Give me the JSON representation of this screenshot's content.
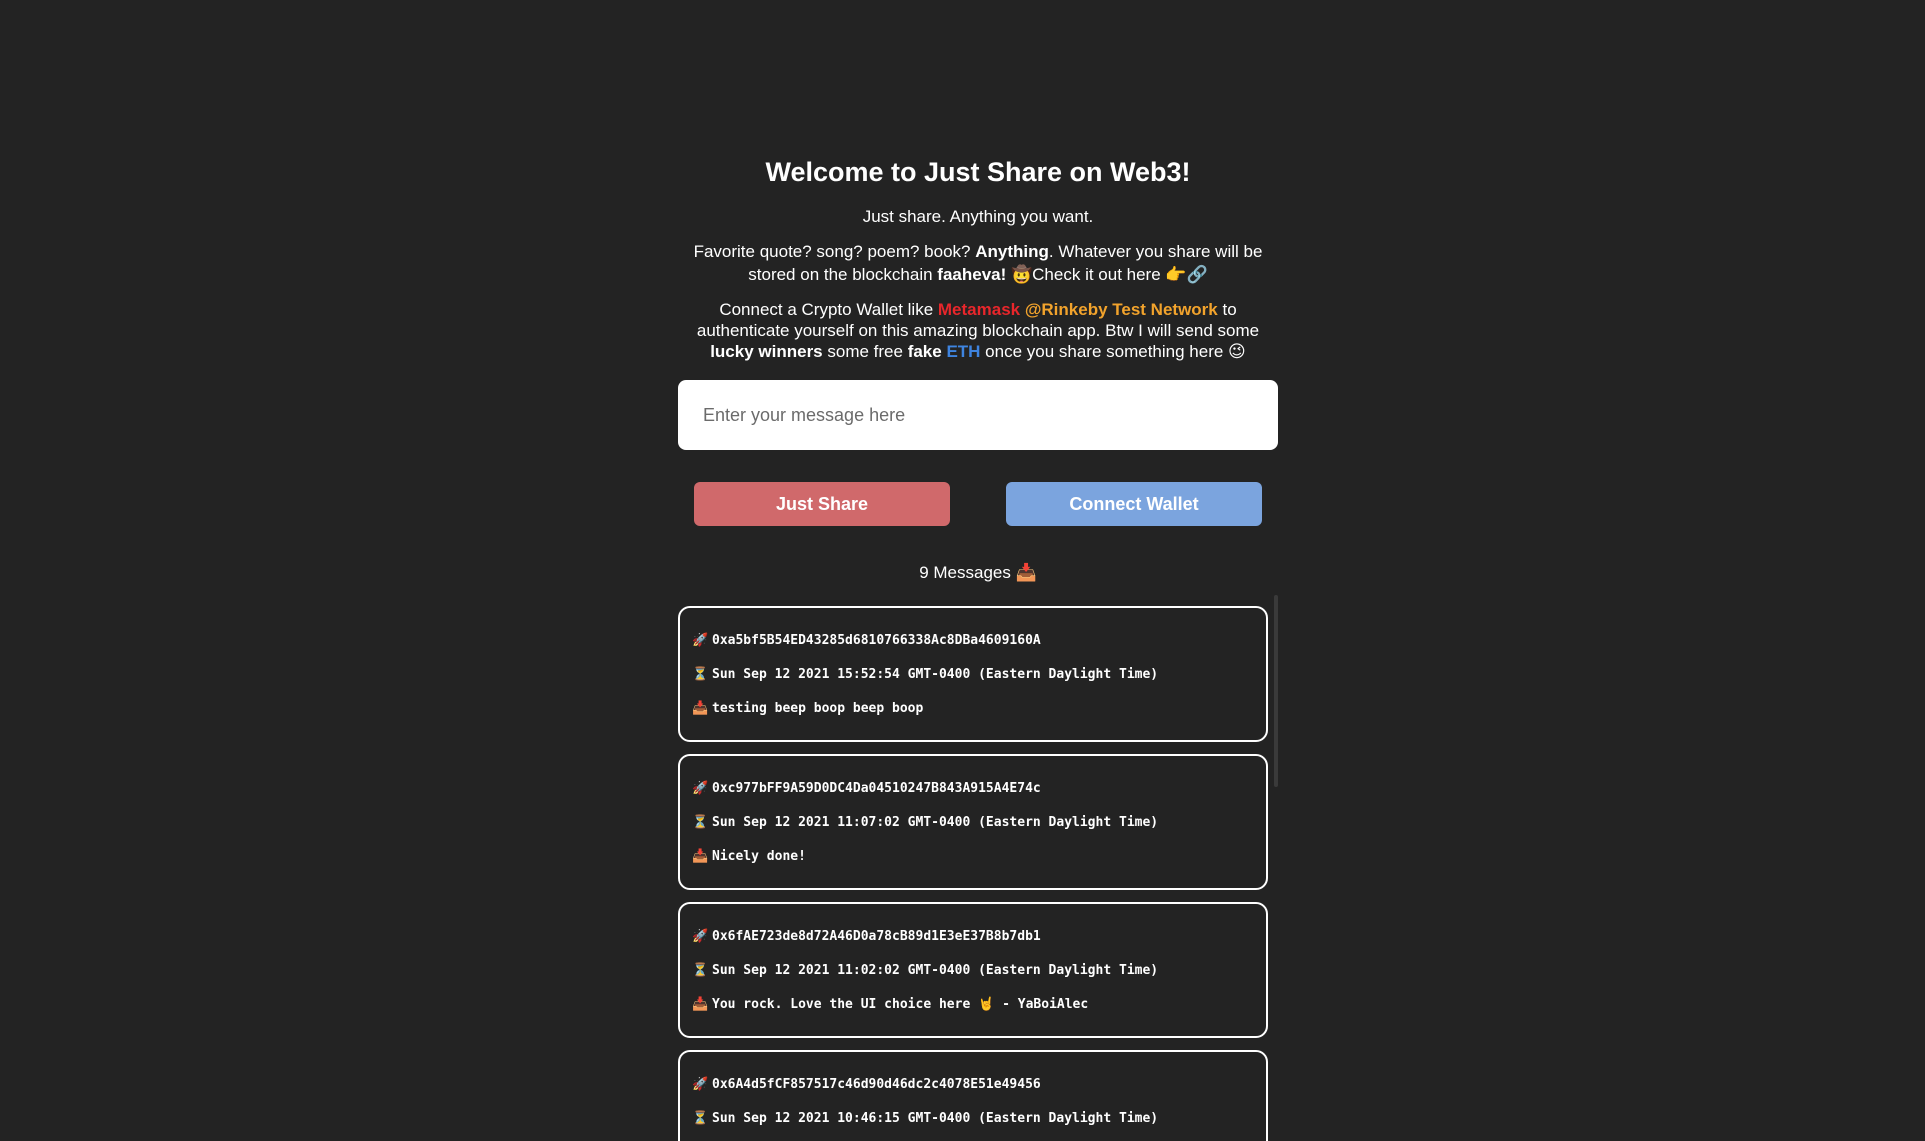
{
  "header": {
    "title": "Welcome to Just Share on Web3!",
    "tagline": "Just share. Anything you want."
  },
  "intro": {
    "a": "Favorite quote? song? poem? book? ",
    "b": "Anything",
    "c": ". Whatever you share will be stored on the blockchain ",
    "d": "faaheva!",
    "e": " 🤠Check it out here 👉🔗"
  },
  "wallet_info": {
    "a": "Connect a Crypto Wallet like ",
    "metamask": "Metamask",
    "network": " @Rinkeby Test Network",
    "b": " to authenticate yourself on this amazing blockchain app. Btw I will send some ",
    "lucky": "lucky winners",
    "c": " some free ",
    "fake": "fake",
    "eth": " ETH",
    "d": " once you share something here 😉"
  },
  "input": {
    "placeholder": "Enter your message here",
    "value": ""
  },
  "buttons": {
    "share": "Just Share",
    "connect": "Connect Wallet"
  },
  "message_count": "9 Messages 📥",
  "icons": {
    "address": "🚀",
    "time": "⏳",
    "message": "📥"
  },
  "colors": {
    "background": "#232323",
    "metamask": "#e8262b",
    "network": "#f2a32c",
    "eth": "#3e84e0",
    "share_button": "#d0696b",
    "connect_button": "#7ba4de"
  },
  "messages": [
    {
      "address": "0xa5bf5B54ED43285d6810766338Ac8DBa4609160A",
      "timestamp": "Sun Sep 12 2021 15:52:54 GMT-0400 (Eastern Daylight Time)",
      "text": "testing beep boop beep boop"
    },
    {
      "address": "0xc977bFF9A59D0DC4Da04510247B843A915A4E74c",
      "timestamp": "Sun Sep 12 2021 11:07:02 GMT-0400 (Eastern Daylight Time)",
      "text": "Nicely done!"
    },
    {
      "address": "0x6fAE723de8d72A46D0a78cB89d1E3eE37B8b7db1",
      "timestamp": "Sun Sep 12 2021 11:02:02 GMT-0400 (Eastern Daylight Time)",
      "text": "You rock. Love the UI choice here 🤘 - YaBoiAlec"
    },
    {
      "address": "0x6A4d5fCF857517c46d90d46dc2c4078E51e49456",
      "timestamp": "Sun Sep 12 2021 10:46:15 GMT-0400 (Eastern Daylight Time)",
      "text": ""
    }
  ]
}
